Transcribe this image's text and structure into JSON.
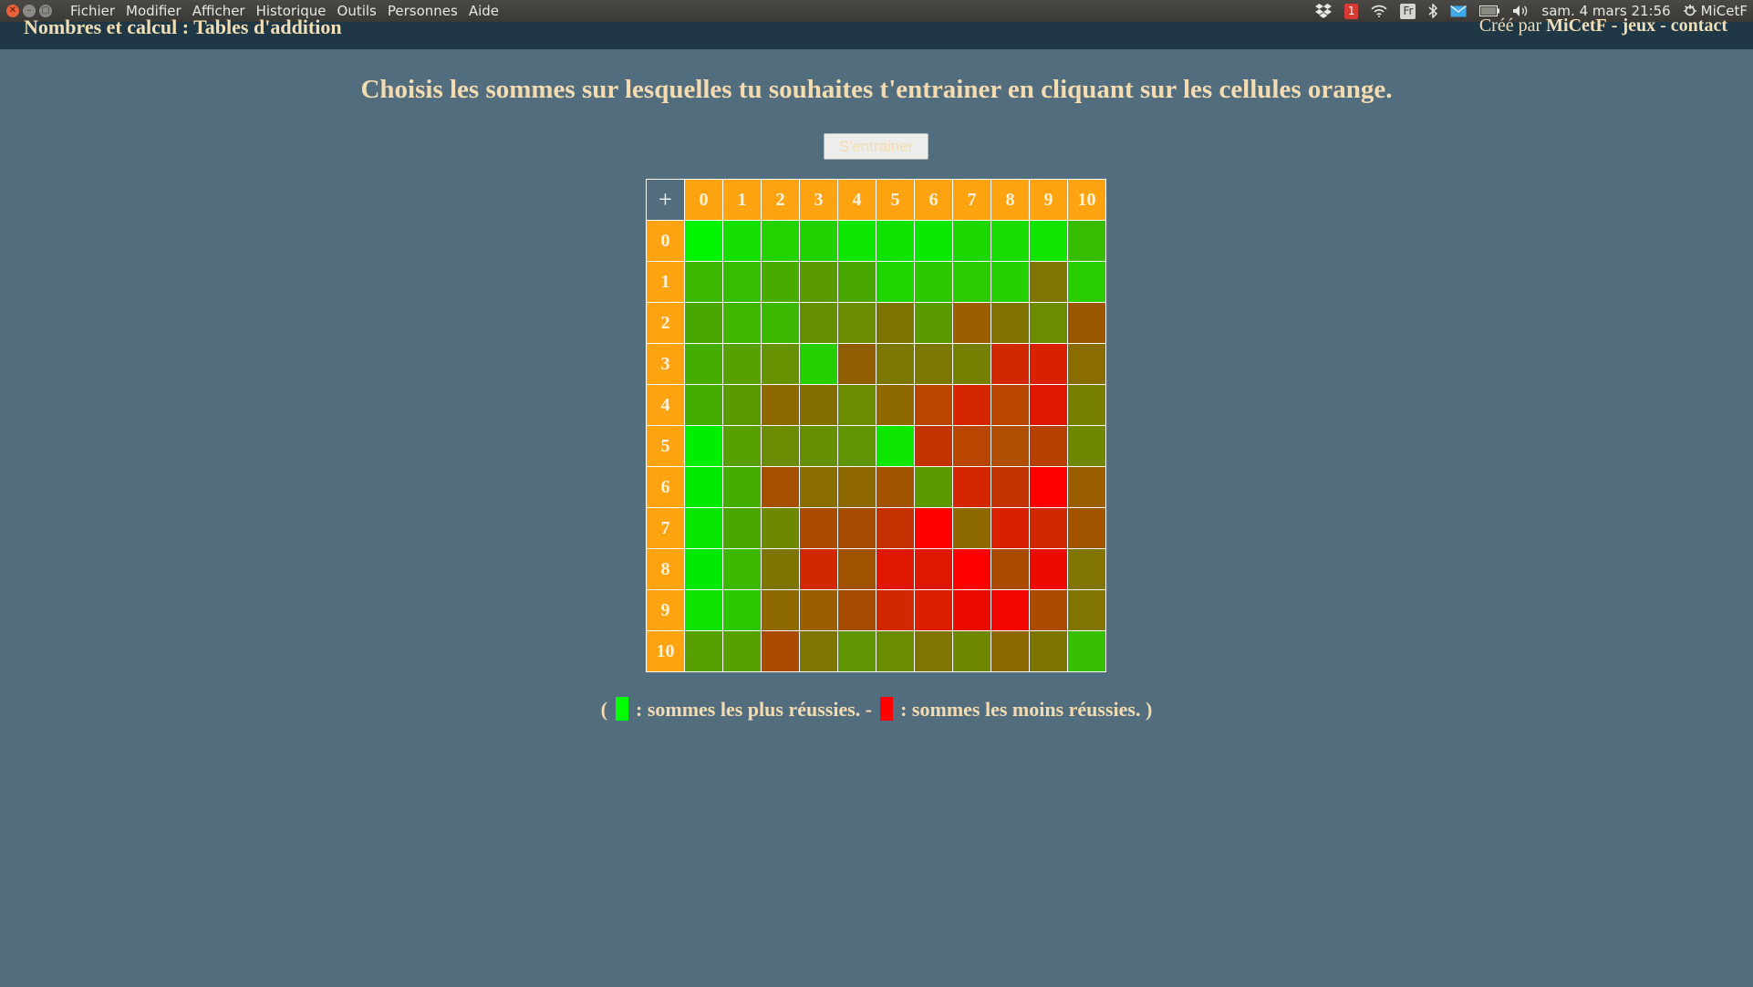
{
  "menubar": {
    "items": [
      "Fichier",
      "Modifier",
      "Afficher",
      "Historique",
      "Outils",
      "Personnes",
      "Aide"
    ],
    "notification_count": "1",
    "keyboard_layout": "Fr",
    "datetime": "sam. 4 mars 21:56",
    "user": "MiCetF"
  },
  "header": {
    "site_title": "Nombres et calcul : Tables d'addition",
    "created_by": "Créé par",
    "author": "MiCetF",
    "sep1": "-",
    "games_link": "jeux",
    "sep2": "-",
    "contact_link": "contact"
  },
  "instruction": "Choisis les sommes sur lesquelles tu souhaites t'entrainer en cliquant sur les cellules orange.",
  "train_button": "S'entrainer",
  "table": {
    "corner": "+",
    "columns": [
      "0",
      "1",
      "2",
      "3",
      "4",
      "5",
      "6",
      "7",
      "8",
      "9",
      "10"
    ],
    "rows": [
      "0",
      "1",
      "2",
      "3",
      "4",
      "5",
      "6",
      "7",
      "8",
      "9",
      "10"
    ],
    "header_color": "#ffa410",
    "cell_colors": [
      [
        "#00f300",
        "#14e000",
        "#22d300",
        "#22d200",
        "#0ee700",
        "#11e300",
        "#0ce900",
        "#1dd700",
        "#19dc00",
        "#11e400",
        "#38bc00"
      ],
      [
        "#3cb800",
        "#37bd00",
        "#47ab00",
        "#5a9900",
        "#4aa700",
        "#1fd500",
        "#2dc700",
        "#2acb00",
        "#25d000",
        "#807500",
        "#28cd00"
      ],
      [
        "#4aa700",
        "#3fb500",
        "#3ab900",
        "#649000",
        "#6b8b00",
        "#7d7500",
        "#5a9900",
        "#9b5f00",
        "#807200",
        "#6b8b00",
        "#9b5700"
      ],
      [
        "#45ad00",
        "#57a000",
        "#669200",
        "#26d000",
        "#905e00",
        "#7a7800",
        "#7a7800",
        "#758000",
        "#d22800",
        "#d92100",
        "#8a6d00"
      ],
      [
        "#45ad00",
        "#5a9900",
        "#8d6900",
        "#826f00",
        "#6b8b00",
        "#8d6900",
        "#b84600",
        "#d52600",
        "#b84600",
        "#e01700",
        "#758000"
      ],
      [
        "#00ee00",
        "#57a000",
        "#6b8b00",
        "#649000",
        "#5f9500",
        "#0ee700",
        "#c33300",
        "#b84600",
        "#b04e00",
        "#b54000",
        "#6e8800"
      ],
      [
        "#00ea00",
        "#45ad00",
        "#a55000",
        "#8a6d00",
        "#906800",
        "#a15300",
        "#5a9900",
        "#d52600",
        "#c33300",
        "#fe0000",
        "#9b5f00"
      ],
      [
        "#08e700",
        "#4aa700",
        "#6e8800",
        "#ab4b00",
        "#a64c00",
        "#c43000",
        "#fe0000",
        "#8d6900",
        "#d92100",
        "#d22800",
        "#a15300"
      ],
      [
        "#00e900",
        "#3cb800",
        "#7d7500",
        "#d22800",
        "#a15300",
        "#e01700",
        "#e01700",
        "#fe0000",
        "#ab4b00",
        "#ec0b00",
        "#807500"
      ],
      [
        "#11e300",
        "#2dc700",
        "#8d6900",
        "#9b5f00",
        "#a64c00",
        "#d22800",
        "#dd1e00",
        "#ec0b00",
        "#f10600",
        "#ab4b00",
        "#807500"
      ],
      [
        "#57a000",
        "#57a000",
        "#ab4b00",
        "#807500",
        "#5f9500",
        "#6b8b00",
        "#807500",
        "#6e8800",
        "#8d6900",
        "#7d7500",
        "#35bf00"
      ]
    ]
  },
  "legend": {
    "open": "(",
    "good_text": ": sommes les plus réussies. -",
    "bad_text": ": sommes les moins réussies. )",
    "good_color": "#00ff00",
    "bad_color": "#ff0000"
  }
}
